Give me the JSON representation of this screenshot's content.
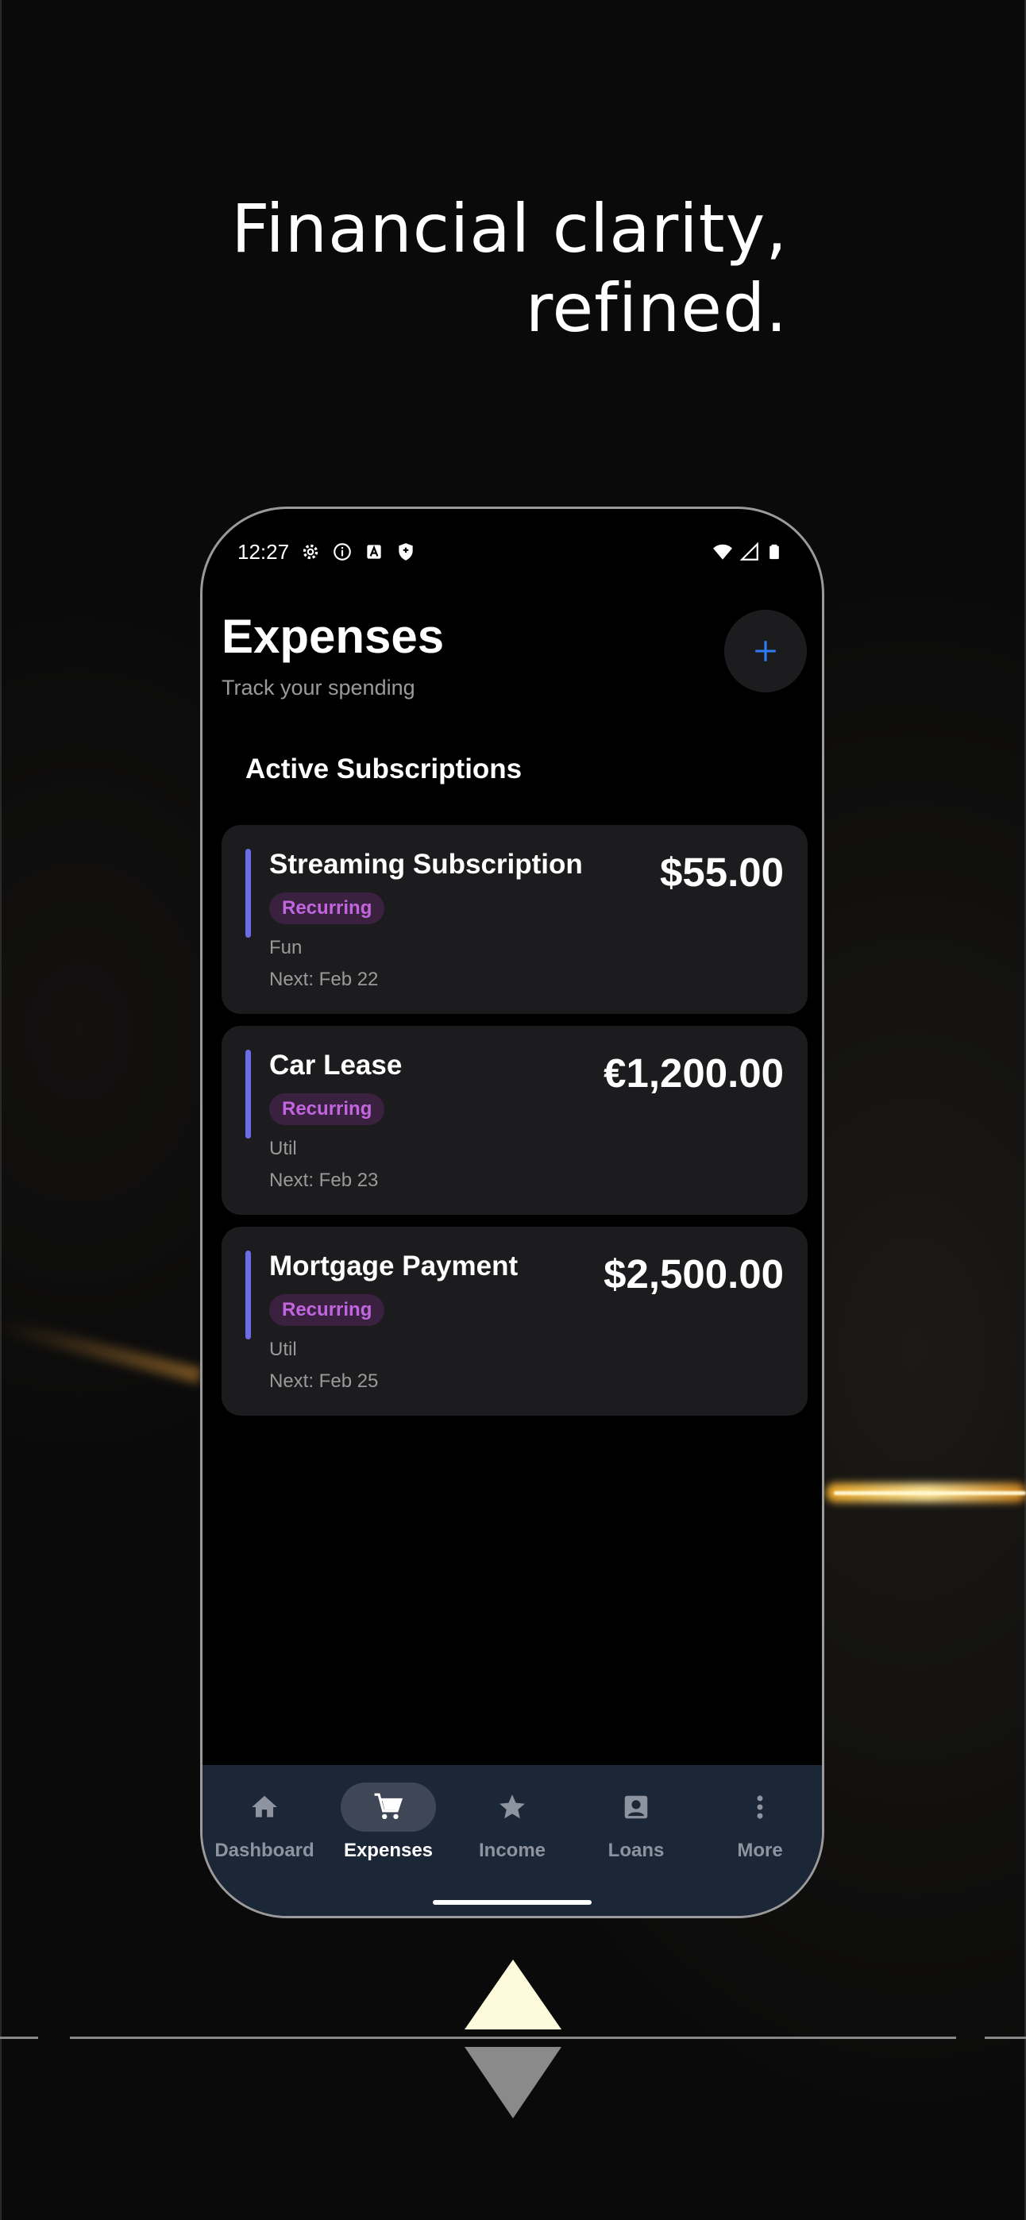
{
  "headline": {
    "line1": "Financial clarity,",
    "line2": "refined."
  },
  "status_bar": {
    "time": "12:27"
  },
  "header": {
    "title": "Expenses",
    "subtitle": "Track your spending",
    "add_button_label": "+"
  },
  "section_title": "Active Subscriptions",
  "subscriptions": [
    {
      "name": "Streaming Subscription",
      "amount": "$55.00",
      "badge": "Recurring",
      "category": "Fun",
      "next": "Next: Feb 22"
    },
    {
      "name": "Car Lease",
      "amount": "€1,200.00",
      "badge": "Recurring",
      "category": "Util",
      "next": "Next: Feb 23"
    },
    {
      "name": "Mortgage Payment",
      "amount": "$2,500.00",
      "badge": "Recurring",
      "category": "Util",
      "next": "Next: Feb 25"
    }
  ],
  "nav": {
    "items": [
      {
        "label": "Dashboard",
        "icon": "home-icon"
      },
      {
        "label": "Expenses",
        "icon": "cart-icon",
        "active": true
      },
      {
        "label": "Income",
        "icon": "star-icon"
      },
      {
        "label": "Loans",
        "icon": "contact-icon"
      },
      {
        "label": "More",
        "icon": "more-vert-icon"
      }
    ]
  },
  "colors": {
    "accent_blue": "#2f7cf6",
    "accent_bar": "#6c6ce6",
    "badge_text": "#c266e0",
    "badge_bg": "#3a2140",
    "card_bg": "#1c1c1e",
    "nav_bg": "#1b2637"
  }
}
